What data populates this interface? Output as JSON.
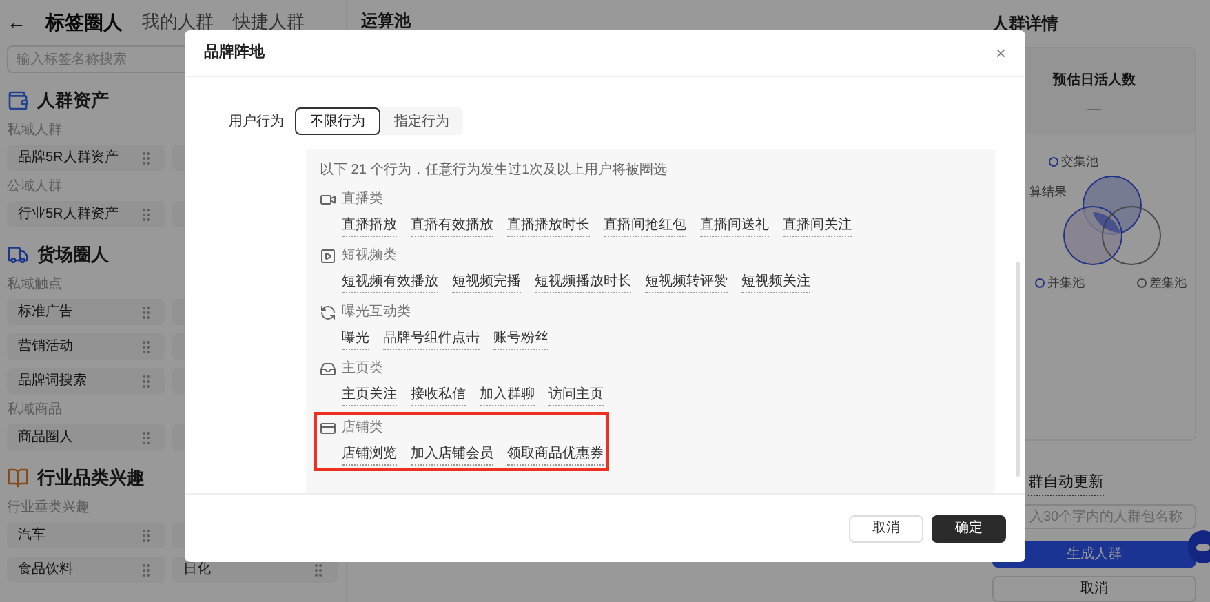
{
  "sidebar": {
    "back": "←",
    "tabs": [
      {
        "label": "标签圈人",
        "selected": true
      },
      {
        "label": "我的人群",
        "selected": false
      },
      {
        "label": "快捷人群",
        "selected": false
      }
    ],
    "search": {
      "placeholder": "输入标签名称搜索"
    },
    "sections": [
      {
        "title": "人群资产",
        "kind": "wallet",
        "groups": [
          {
            "title": "私域人群",
            "items": [
              {
                "label": "品牌5R人群资产"
              }
            ]
          },
          {
            "title": "公域人群",
            "items": [
              {
                "label": "行业5R人群资产"
              }
            ]
          }
        ]
      },
      {
        "title": "货场圈人",
        "kind": "truck",
        "groups": [
          {
            "title": "私域触点",
            "items": [
              {
                "label": "标准广告"
              },
              {
                "label": "营销活动"
              },
              {
                "label": "品牌词搜索"
              }
            ]
          },
          {
            "title": "私域商品",
            "items": [
              {
                "label": "商品圈人"
              }
            ]
          }
        ]
      },
      {
        "title": "行业品类兴趣",
        "kind": "book",
        "groups": [
          {
            "title": "行业垂类兴趣",
            "items": [
              {
                "label": "汽车"
              },
              {
                "label": "食品饮料",
                "pair": "日化"
              }
            ]
          }
        ]
      }
    ]
  },
  "pool": {
    "title": "运算池"
  },
  "details": {
    "title": "人群详情",
    "estimate_label": "预估日活人数",
    "estimate_value": "—",
    "venn_labels": [
      {
        "label": "交集池",
        "kind": "ring",
        "color": "#233386"
      },
      {
        "label": "算结果",
        "kind": "plain"
      },
      {
        "label": "并集池",
        "kind": "ring",
        "color": "#233386"
      },
      {
        "label": "差集池",
        "kind": "ring",
        "color": "#474747"
      }
    ],
    "auto_update": "群自动更新",
    "name_field": {
      "placeholder": "入30个字内的人群包名称"
    },
    "buttons": [
      {
        "label": "生成人群",
        "kind": "primary"
      },
      {
        "label": "取消",
        "kind": "secondary"
      }
    ]
  },
  "modal": {
    "title": "品牌阵地",
    "close": "×",
    "behavior": {
      "label": "用户行为",
      "options": [
        {
          "label": "不限行为",
          "selected": true
        },
        {
          "label": "指定行为",
          "selected": false
        }
      ]
    },
    "panel": {
      "note": "以下 21 个行为，任意行为发生过1次及以上用户将被圈选",
      "categories": [
        {
          "name": "直播类",
          "kind": "live",
          "highlighted": false,
          "items": [
            "直播播放",
            "直播有效播放",
            "直播播放时长",
            "直播间抢红包",
            "直播间送礼",
            "直播间关注"
          ]
        },
        {
          "name": "短视频类",
          "kind": "video",
          "highlighted": false,
          "items": [
            "短视频有效播放",
            "短视频完播",
            "短视频播放时长",
            "短视频转评赞",
            "短视频关注"
          ]
        },
        {
          "name": "曝光互动类",
          "kind": "exposure",
          "highlighted": false,
          "items": [
            "曝光",
            "品牌号组件点击",
            "账号粉丝"
          ]
        },
        {
          "name": "主页类",
          "kind": "home",
          "highlighted": false,
          "items": [
            "主页关注",
            "接收私信",
            "加入群聊",
            "访问主页"
          ]
        },
        {
          "name": "店铺类",
          "kind": "store",
          "highlighted": true,
          "items": [
            "店铺浏览",
            "加入店铺会员",
            "领取商品优惠券"
          ]
        }
      ]
    },
    "buttons": [
      {
        "label": "取消",
        "kind": "secondary"
      },
      {
        "label": "确定",
        "kind": "primary"
      }
    ]
  }
}
